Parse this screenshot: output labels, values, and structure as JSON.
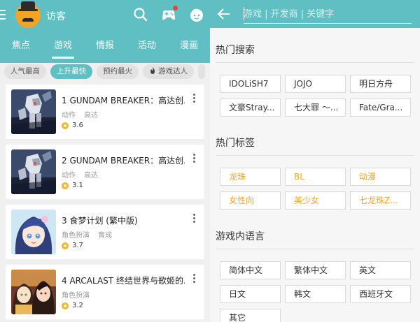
{
  "left": {
    "visitor_label": "访客",
    "tabs": [
      {
        "label": "焦点"
      },
      {
        "label": "游戏"
      },
      {
        "label": "情报"
      },
      {
        "label": "活动"
      },
      {
        "label": "漫画"
      }
    ],
    "active_tab_index": 1,
    "filters": [
      {
        "label": "人气最高"
      },
      {
        "label": "上升最快"
      },
      {
        "label": "预约最火"
      },
      {
        "label": "游戏达人"
      }
    ],
    "active_filter_index": 1,
    "games": [
      {
        "rank": "1",
        "title": "GUNDAM BREAKER：高达创...",
        "tags": [
          "动作",
          "高达"
        ],
        "rating": "3.6",
        "thumb": "robot"
      },
      {
        "rank": "2",
        "title": "GUNDAM BREAKER：高达创...",
        "tags": [
          "动作",
          "高达"
        ],
        "rating": "3.1",
        "thumb": "robot"
      },
      {
        "rank": "3",
        "title": "食梦计划 (繁中版)",
        "tags": [
          "角色扮演",
          "育成"
        ],
        "rating": "3.7",
        "thumb": "anime-girl"
      },
      {
        "rank": "4",
        "title": "ARCALAST 终结世界与歌姬的...",
        "tags": [
          "角色扮演"
        ],
        "rating": "3.2",
        "thumb": "anime-duo"
      }
    ]
  },
  "right": {
    "search_placeholder": "游戏 | 开发商 | 关键字",
    "hot_search_title": "热门搜索",
    "hot_search": [
      "IDOLiSH7",
      "JOJO",
      "明日方舟",
      "文豪Stray...",
      "七大罪 ～...",
      "Fate/Gra..."
    ],
    "hot_tags_title": "热门标签",
    "hot_tags": [
      "龙珠",
      "BL",
      "动漫",
      "女性向",
      "美少女",
      "七龙珠Z..."
    ],
    "lang_title": "游戏内语言",
    "languages": [
      "简体中文",
      "繁体中文",
      "英文",
      "日文",
      "韩文",
      "西班牙文",
      "其它"
    ]
  },
  "colors": {
    "accent": "#5fbfc3",
    "tag_orange": "#f5a623",
    "coin": "#f5b62a",
    "notification": "#e8453c"
  },
  "icons": {
    "menu": "menu-icon",
    "avatar": "mustache-avatar-icon",
    "search": "search-icon",
    "gamepad": "gamepad-icon",
    "face": "face-icon",
    "back": "arrow-left-icon",
    "more": "more-vertical-icon",
    "rating": "coin-icon"
  }
}
